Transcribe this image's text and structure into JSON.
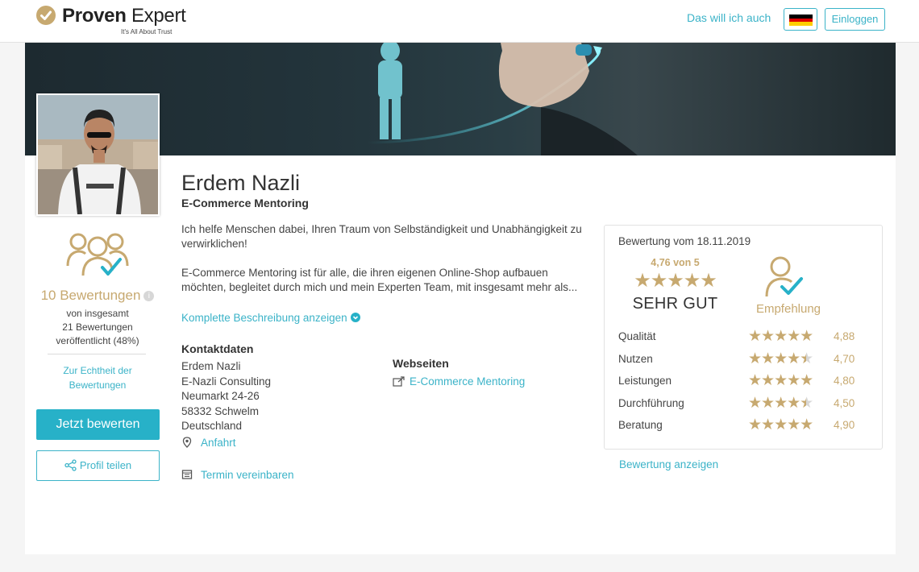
{
  "header": {
    "brand_bold": "Proven",
    "brand_light": "Expert",
    "tagline": "It's All About Trust",
    "nav_link": "Das will ich auch",
    "login_label": "Einloggen",
    "flag_icon": "germany-flag-icon"
  },
  "profile": {
    "name": "Erdem Nazli",
    "subtitle": "E-Commerce Mentoring",
    "description_1": "Ich helfe Menschen dabei, Ihren Traum von Selbständigkeit und Unabhängigkeit zu verwirklichen!",
    "description_2": "E-Commerce Mentoring ist für alle, die ihren eigenen Online-Shop aufbauen möchten, begleitet durch mich und mein Experten Team, mit insgesamt mehr als...",
    "more_link": "Komplette Beschreibung anzeigen"
  },
  "sidebar": {
    "review_count": "10 Bewertungen",
    "review_sub_1": "von insgesamt",
    "review_sub_2": "21 Bewertungen",
    "review_sub_3": "veröffentlicht (48%)",
    "authenticity_link": "Zur Echtheit der Bewertungen",
    "rate_button": "Jetzt bewerten",
    "share_button": "Profil teilen"
  },
  "contact": {
    "heading": "Kontaktdaten",
    "lines": [
      "Erdem Nazli",
      "E-Nazli Consulting",
      "Neumarkt 24-26",
      "58332 Schwelm",
      "Deutschland"
    ],
    "directions_link": "Anfahrt",
    "appointment_link": "Termin vereinbaren"
  },
  "websites": {
    "heading": "Webseiten",
    "link": "E-Commerce Mentoring"
  },
  "rating": {
    "date_label": "Bewertung vom 18.11.2019",
    "score_label": "4,76 von 5",
    "score": 4.76,
    "verdict": "SEHR GUT",
    "recommendation": "Empfehlung",
    "categories": [
      {
        "name": "Qualität",
        "value": "4,88",
        "stars": 5
      },
      {
        "name": "Nutzen",
        "value": "4,70",
        "stars": 4.5
      },
      {
        "name": "Leistungen",
        "value": "4,80",
        "stars": 5
      },
      {
        "name": "Durchführung",
        "value": "4,50",
        "stars": 4.5
      },
      {
        "name": "Beratung",
        "value": "4,90",
        "stars": 5
      }
    ],
    "show_link": "Bewertung anzeigen"
  },
  "colors": {
    "accent": "#3bb3c8",
    "gold": "#c7a970",
    "button": "#27b1c8"
  }
}
